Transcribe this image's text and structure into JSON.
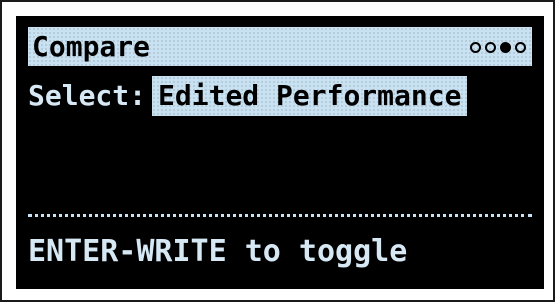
{
  "header": {
    "title": "Compare",
    "page_indicator": {
      "total": 4,
      "active_index": 2
    }
  },
  "select": {
    "label": "Select:",
    "value": "Edited Performance"
  },
  "footer": {
    "hint": "ENTER-WRITE to toggle"
  },
  "colors": {
    "screen_background": "#000000",
    "highlight": "#c9e2f3",
    "text": "#d6e8f4"
  }
}
